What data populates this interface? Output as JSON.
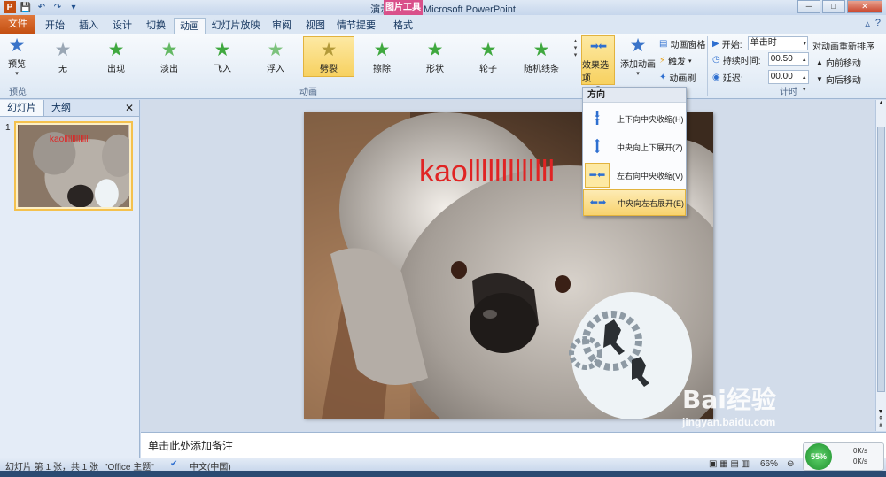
{
  "window": {
    "title": "演示文稿1 - Microsoft PowerPoint",
    "picture_tools": "图片工具",
    "minimize": "─",
    "maximize": "□",
    "close": "✕"
  },
  "qat": {
    "save": "💾",
    "undo": "↶",
    "redo": "↷",
    "more": "▾"
  },
  "tabs": [
    "开始",
    "插入",
    "设计",
    "切换",
    "动画",
    "幻灯片放映",
    "审阅",
    "视图",
    "情节提要",
    "格式"
  ],
  "file_tab": "文件",
  "tab_help": "?",
  "ribbon": {
    "preview": {
      "label": "预览",
      "group": "预览"
    },
    "animations_group": "动画",
    "animations": [
      {
        "label": "无",
        "color": "#9aa7b5"
      },
      {
        "label": "出现",
        "color": "#3fa83f"
      },
      {
        "label": "淡出",
        "color": "#63b863"
      },
      {
        "label": "飞入",
        "color": "#3fa83f"
      },
      {
        "label": "浮入",
        "color": "#7cc27c"
      },
      {
        "label": "劈裂",
        "color": "#b39a3a"
      },
      {
        "label": "擦除",
        "color": "#3fa83f"
      },
      {
        "label": "形状",
        "color": "#3fa83f"
      },
      {
        "label": "轮子",
        "color": "#3fa83f"
      },
      {
        "label": "随机线条",
        "color": "#3fa83f"
      }
    ],
    "selected_animation": "劈裂",
    "effect_options": "效果选项",
    "add_animation": "添加动画",
    "anim_pane": "动画窗格",
    "trigger": "触发",
    "anim_painter": "动画刷",
    "timing_group": "计时",
    "start_label": "开始:",
    "start_value": "单击时",
    "duration_label": "持续时间:",
    "duration_value": "00.50",
    "delay_label": "延迟:",
    "delay_value": "00.00",
    "reorder_title": "对动画重新排序",
    "move_earlier": "向前移动",
    "move_later": "向后移动"
  },
  "left_panel": {
    "tab_slides": "幻灯片",
    "tab_outline": "大纲",
    "close": "✕",
    "slide_number": "1"
  },
  "slide": {
    "text": "kaolllllllllllll"
  },
  "dropdown": {
    "header": "方向",
    "items": [
      {
        "label": "上下向中央收缩(H)",
        "selected": false
      },
      {
        "label": "中央向上下展开(Z)",
        "selected": false
      },
      {
        "label": "左右向中央收缩(V)",
        "selected": true
      },
      {
        "label": "中央向左右展开(E)",
        "selected": false,
        "hover": true
      }
    ]
  },
  "notes_placeholder": "单击此处添加备注",
  "status": {
    "slide_info": "幻灯片 第 1 张，共 1 张",
    "theme": "\"Office 主题\"",
    "language": "中文(中国)",
    "zoom": "66%"
  },
  "net": {
    "percent": "55%",
    "up": "0K/s",
    "down": "0K/s"
  },
  "watermark": {
    "line1": "Bai经验",
    "line2": "jingyan.baidu.com"
  }
}
